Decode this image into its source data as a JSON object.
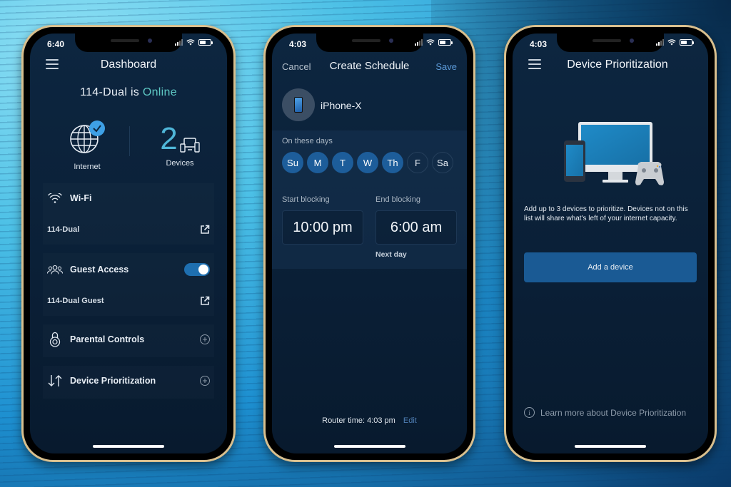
{
  "phones": [
    {
      "name": "dashboard",
      "status": {
        "time": "6:40"
      },
      "title": "Dashboard",
      "router_name": "114-Dual is",
      "router_status": "Online",
      "tiles": {
        "internet_label": "Internet",
        "devices_count": "2",
        "devices_label": "Devices"
      },
      "wifi": {
        "label": "Wi-Fi",
        "network": "114-Dual"
      },
      "guest": {
        "label": "Guest Access",
        "enabled": true,
        "network": "114-Dual Guest"
      },
      "parental": {
        "label": "Parental Controls"
      },
      "prioritization": {
        "label": "Device Prioritization"
      }
    },
    {
      "name": "create-schedule",
      "status": {
        "time": "4:03"
      },
      "cancel": "Cancel",
      "title": "Create Schedule",
      "save": "Save",
      "device": "iPhone-X",
      "days_label": "On these days",
      "days": [
        {
          "label": "Su",
          "selected": true
        },
        {
          "label": "M",
          "selected": true
        },
        {
          "label": "T",
          "selected": true
        },
        {
          "label": "W",
          "selected": true
        },
        {
          "label": "Th",
          "selected": true
        },
        {
          "label": "F",
          "selected": false
        },
        {
          "label": "Sa",
          "selected": false
        }
      ],
      "start_label": "Start blocking",
      "start_time": "10:00 pm",
      "end_label": "End blocking",
      "end_time": "6:00 am",
      "end_note": "Next day",
      "router_time": "Router time: 4:03 pm",
      "edit": "Edit"
    },
    {
      "name": "device-prioritization",
      "status": {
        "time": "4:03"
      },
      "title": "Device Prioritization",
      "description": "Add up to 3 devices to prioritize. Devices not on this list will share what's left of your internet capacity.",
      "add_button": "Add a device",
      "learn_more": "Learn more about Device Prioritization"
    }
  ],
  "colors": {
    "accent": "#1d5d9a",
    "online": "#5ec8c4",
    "save": "#5c9ad8",
    "screen_bg": "#0a1f36",
    "frame": "#d8bf8e"
  }
}
